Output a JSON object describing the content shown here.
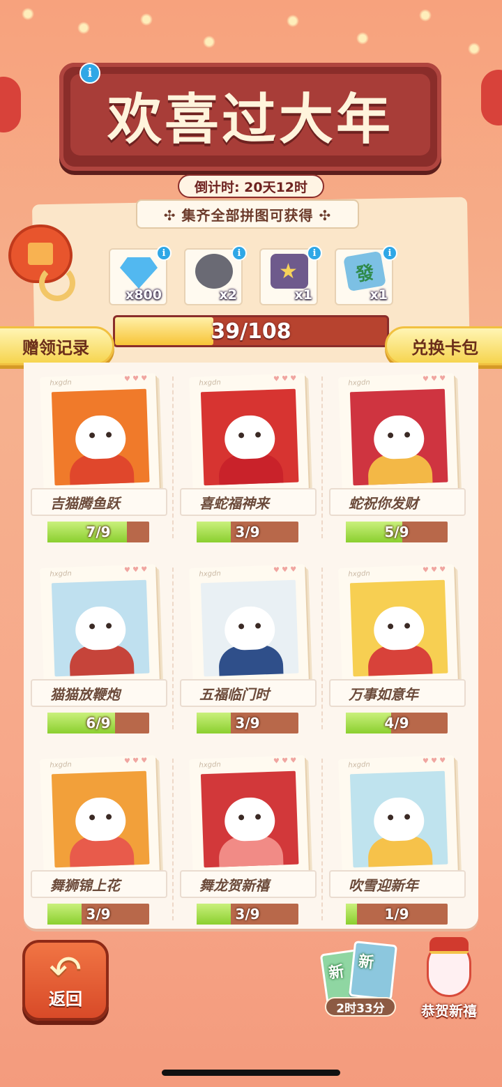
{
  "event": {
    "title": "欢喜过大年",
    "countdown": "倒计时: 20天12时"
  },
  "rewards": {
    "heading": "✣ 集齐全部拼图可获得 ✣",
    "items": [
      {
        "icon": "diamond-icon",
        "qty": "x800",
        "color": "#52b8f0"
      },
      {
        "icon": "raccoon-avatar-icon",
        "qty": "x2",
        "color": "#6a6a74"
      },
      {
        "icon": "star-frame-icon",
        "qty": "x1",
        "color": "#6e5a8c"
      },
      {
        "icon": "mahjong-tile-icon",
        "qty": "x1",
        "color": "#7cc0e4"
      }
    ]
  },
  "progress": {
    "label": "39/108",
    "current": 39,
    "total": 108
  },
  "buttons": {
    "gift_records": "赠领记录",
    "exchange_pack": "兑换卡包",
    "back": "返回"
  },
  "album": {
    "brand": "hxgdn",
    "hearts": "♥ ♥ ♥",
    "cards": [
      {
        "name": "吉猫腾鱼跃",
        "progress": "7/9",
        "collected": 7,
        "total": 9,
        "bg": "#f07a2a",
        "accent": "#e0472c"
      },
      {
        "name": "喜蛇福神来",
        "progress": "3/9",
        "collected": 3,
        "total": 9,
        "bg": "#d73431",
        "accent": "#c9222a"
      },
      {
        "name": "蛇祝你发财",
        "progress": "5/9",
        "collected": 5,
        "total": 9,
        "bg": "#cf3440",
        "accent": "#f3b846"
      },
      {
        "name": "猫猫放鞭炮",
        "progress": "6/9",
        "collected": 6,
        "total": 9,
        "bg": "#bfe0ef",
        "accent": "#c6443a"
      },
      {
        "name": "五福临门时",
        "progress": "3/9",
        "collected": 3,
        "total": 9,
        "bg": "#e9f0f4",
        "accent": "#2f4f8a"
      },
      {
        "name": "万事如意年",
        "progress": "4/9",
        "collected": 4,
        "total": 9,
        "bg": "#f7cf52",
        "accent": "#d8423a"
      },
      {
        "name": "舞狮锦上花",
        "progress": "3/9",
        "collected": 3,
        "total": 9,
        "bg": "#f2a03a",
        "accent": "#e85b4b"
      },
      {
        "name": "舞龙贺新禧",
        "progress": "3/9",
        "collected": 3,
        "total": 9,
        "bg": "#d2383a",
        "accent": "#f18b86"
      },
      {
        "name": "吹雪迎新年",
        "progress": "1/9",
        "collected": 1,
        "total": 9,
        "bg": "#bfe3ee",
        "accent": "#f6c24a"
      }
    ]
  },
  "bottom": {
    "new_card_badge_1": "新",
    "new_card_badge_2": "新",
    "new_card_timer": "2时33分",
    "greeting": "恭贺新禧"
  }
}
